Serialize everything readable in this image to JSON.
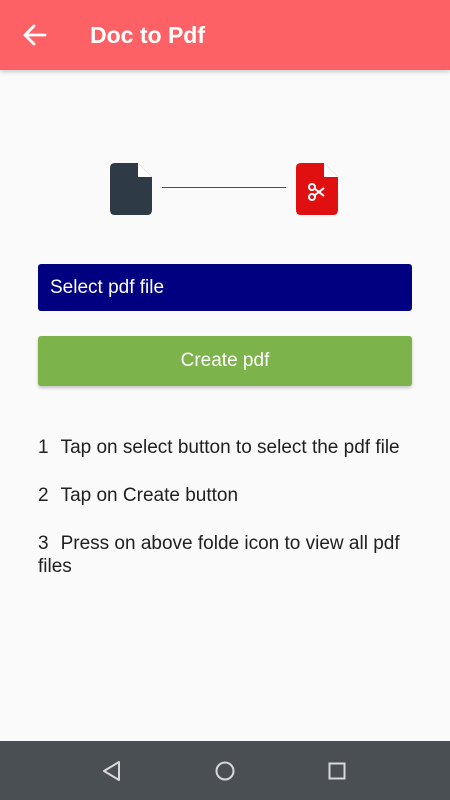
{
  "app_bar": {
    "title": "Doc to Pdf",
    "back_icon": "arrow-left-icon",
    "color": "#fe6165"
  },
  "icons": {
    "source": "document-icon",
    "target": "pdf-cut-icon",
    "source_color": "#2f3a47",
    "target_color": "#e01010"
  },
  "buttons": {
    "select_label": "Select pdf file",
    "select_color": "#000080",
    "create_label": "Create pdf",
    "create_color": "#7cb44b"
  },
  "instructions": [
    {
      "num": "1",
      "text": "Tap on select button to select the pdf file"
    },
    {
      "num": "2",
      "text": "Tap on Create button"
    },
    {
      "num": "3",
      "text": "Press on above folde icon to view all pdf files"
    }
  ],
  "nav_bar": {
    "back": "nav-back-icon",
    "home": "nav-home-icon",
    "recents": "nav-recents-icon"
  }
}
